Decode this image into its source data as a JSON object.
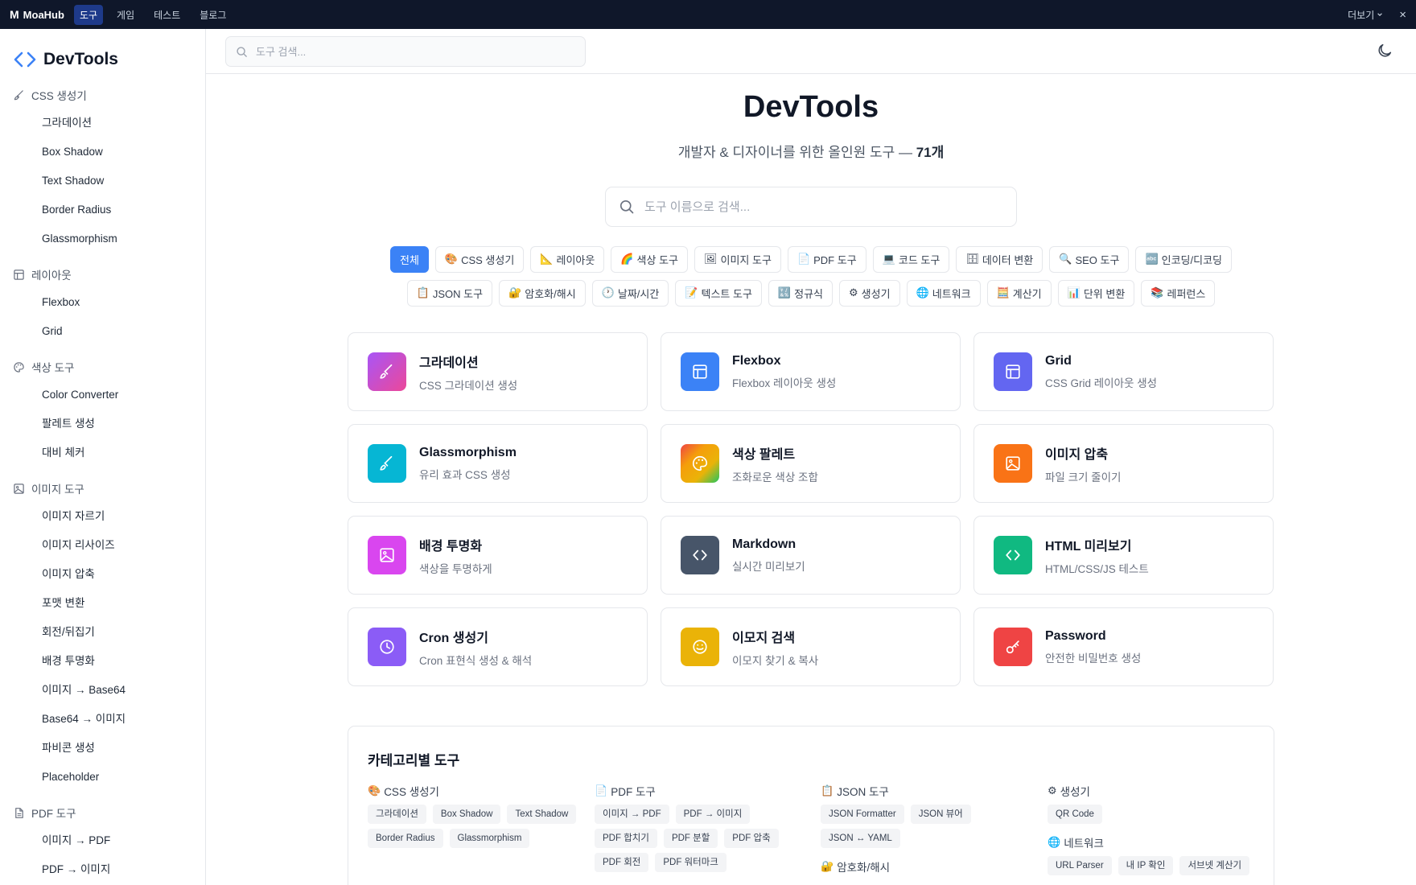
{
  "topbar": {
    "brand_letter": "M",
    "brand": "MoaHub",
    "links": [
      "도구",
      "게임",
      "테스트",
      "블로그"
    ],
    "more": "더보기",
    "close": "×"
  },
  "sidebar": {
    "logo": "DevTools",
    "sections": [
      {
        "title": "CSS 생성기",
        "items": [
          "그라데이션",
          "Box Shadow",
          "Text Shadow",
          "Border Radius",
          "Glassmorphism"
        ]
      },
      {
        "title": "레이아웃",
        "items": [
          "Flexbox",
          "Grid"
        ]
      },
      {
        "title": "색상 도구",
        "items": [
          "Color Converter",
          "팔레트 생성",
          "대비 체커"
        ]
      },
      {
        "title": "이미지 도구",
        "items": [
          "이미지 자르기",
          "이미지 리사이즈",
          "이미지 압축",
          "포맷 변환",
          "회전/뒤집기",
          "배경 투명화",
          "이미지 → Base64",
          "Base64 → 이미지",
          "파비콘 생성",
          "Placeholder"
        ]
      },
      {
        "title": "PDF 도구",
        "items": [
          "이미지 → PDF",
          "PDF → 이미지"
        ]
      }
    ]
  },
  "header": {
    "search_placeholder": "도구 검색..."
  },
  "hero": {
    "title": "DevTools",
    "subtitle": "개발자 & 디자이너를 위한 올인원 도구 — ",
    "count": "71개",
    "search_placeholder": "도구 이름으로 검색..."
  },
  "categories_row1": [
    {
      "emoji": "",
      "label": "전체"
    },
    {
      "emoji": "🎨",
      "label": "CSS 생성기"
    },
    {
      "emoji": "📐",
      "label": "레이아웃"
    },
    {
      "emoji": "🌈",
      "label": "색상 도구"
    },
    {
      "emoji": "🖼",
      "label": "이미지 도구"
    },
    {
      "emoji": "📄",
      "label": "PDF 도구"
    },
    {
      "emoji": "💻",
      "label": "코드 도구"
    },
    {
      "emoji": "🗄",
      "label": "데이터 변환"
    },
    {
      "emoji": "🔍",
      "label": "SEO 도구"
    },
    {
      "emoji": "🔤",
      "label": "인코딩/디코딩"
    }
  ],
  "categories_row2": [
    {
      "emoji": "📋",
      "label": "JSON 도구"
    },
    {
      "emoji": "🔐",
      "label": "암호화/해시"
    },
    {
      "emoji": "🕐",
      "label": "날짜/시간"
    },
    {
      "emoji": "📝",
      "label": "텍스트 도구"
    },
    {
      "emoji": "🔣",
      "label": "정규식"
    },
    {
      "emoji": "⚙",
      "label": "생성기"
    },
    {
      "emoji": "🌐",
      "label": "네트워크"
    },
    {
      "emoji": "🧮",
      "label": "계산기"
    },
    {
      "emoji": "📊",
      "label": "단위 변환"
    },
    {
      "emoji": "📚",
      "label": "레퍼런스"
    }
  ],
  "tools": [
    {
      "title": "그라데이션",
      "desc": "CSS 그라데이션 생성",
      "icon": "paintbrush-icon",
      "color": "#d946ef"
    },
    {
      "title": "Flexbox",
      "desc": "Flexbox 레이아웃 생성",
      "icon": "layout-icon",
      "color": "#3b82f6"
    },
    {
      "title": "Grid",
      "desc": "CSS Grid 레이아웃 생성",
      "icon": "layout-icon",
      "color": "#6366f1"
    },
    {
      "title": "Glassmorphism",
      "desc": "유리 효과 CSS 생성",
      "icon": "paintbrush-icon",
      "color": "#06b6d4"
    },
    {
      "title": "색상 팔레트",
      "desc": "조화로운 색상 조합",
      "icon": "palette-icon",
      "color": "#f59e0b"
    },
    {
      "title": "이미지 압축",
      "desc": "파일 크기 줄이기",
      "icon": "image-icon",
      "color": "#f97316"
    },
    {
      "title": "배경 투명화",
      "desc": "색상을 투명하게",
      "icon": "image-icon",
      "color": "#d946ef"
    },
    {
      "title": "Markdown",
      "desc": "실시간 미리보기",
      "icon": "code-icon",
      "color": "#475569"
    },
    {
      "title": "HTML 미리보기",
      "desc": "HTML/CSS/JS 테스트",
      "icon": "code-icon",
      "color": "#10b981"
    },
    {
      "title": "Cron 생성기",
      "desc": "Cron 표현식 생성 & 해석",
      "icon": "clock-icon",
      "color": "#8b5cf6"
    },
    {
      "title": "이모지 검색",
      "desc": "이모지 찾기 & 복사",
      "icon": "smile-icon",
      "color": "#eab308"
    },
    {
      "title": "Password",
      "desc": "안전한 비밀번호 생성",
      "icon": "key-icon",
      "color": "#ef4444"
    }
  ],
  "by_category": {
    "title": "카테고리별 도구",
    "columns": [
      [
        {
          "emoji": "🎨",
          "title": "CSS 생성기",
          "tags": [
            "그라데이션",
            "Box Shadow",
            "Text Shadow",
            "Border Radius",
            "Glassmorphism"
          ]
        }
      ],
      [
        {
          "emoji": "📄",
          "title": "PDF 도구",
          "tags": [
            "이미지 → PDF",
            "PDF → 이미지",
            "PDF 합치기",
            "PDF 분할",
            "PDF 압축",
            "PDF 회전",
            "PDF 워터마크"
          ]
        }
      ],
      [
        {
          "emoji": "📋",
          "title": "JSON 도구",
          "tags": [
            "JSON Formatter",
            "JSON 뷰어",
            "JSON ↔ YAML"
          ]
        },
        {
          "emoji": "🔐",
          "title": "암호화/해시",
          "tags": []
        }
      ],
      [
        {
          "emoji": "⚙",
          "title": "생성기",
          "tags": [
            "QR Code"
          ]
        },
        {
          "emoji": "🌐",
          "title": "네트워크",
          "tags": [
            "URL Parser",
            "내 IP 확인",
            "서브넷 계산기"
          ]
        }
      ]
    ]
  }
}
